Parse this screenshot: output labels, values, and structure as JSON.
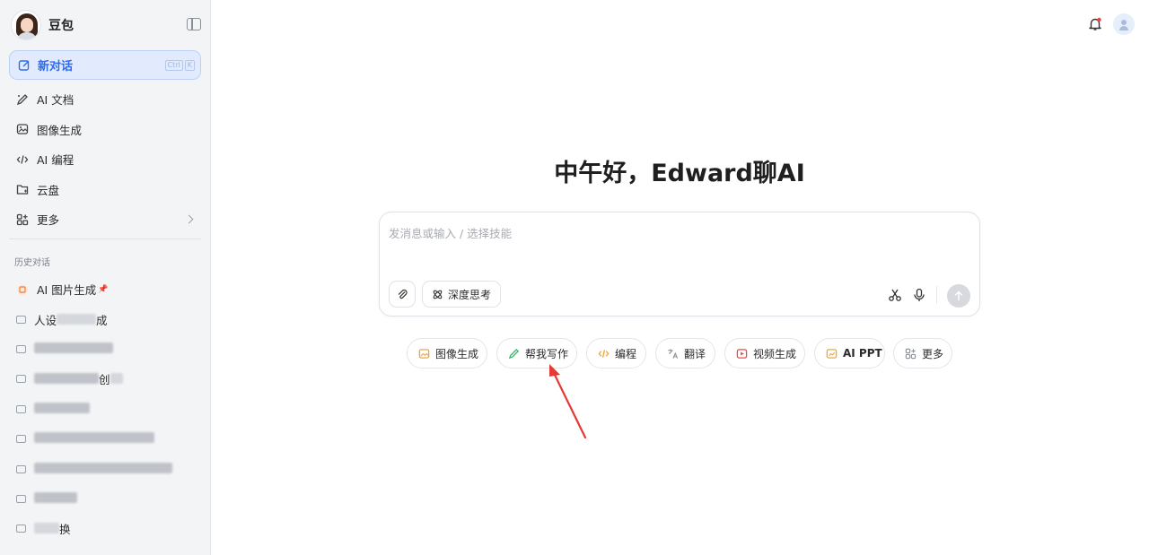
{
  "app": {
    "name": "豆包"
  },
  "sidebar": {
    "new_chat": {
      "label": "新对话",
      "shortcut": [
        "Ctrl",
        "K"
      ]
    },
    "nav": [
      {
        "label": "AI 文档",
        "icon": "pen-icon"
      },
      {
        "label": "图像生成",
        "icon": "image-icon"
      },
      {
        "label": "AI 编程",
        "icon": "code-icon"
      },
      {
        "label": "云盘",
        "icon": "cloud-drive-icon"
      },
      {
        "label": "更多",
        "icon": "grid-icon"
      }
    ],
    "history_title": "历史对话",
    "history": [
      {
        "label": "AI 图片生成",
        "pinned": true
      },
      {
        "label_prefix": "人设",
        "label_suffix": "成",
        "redacted": true
      },
      {
        "redacted": true
      },
      {
        "label_suffix": "创",
        "redacted": true
      },
      {
        "redacted": true
      },
      {
        "redacted": true
      },
      {
        "redacted": true
      },
      {
        "redacted": true
      },
      {
        "label_suffix": "换",
        "redacted": true
      }
    ]
  },
  "main": {
    "greeting": "中午好，Edward聊AI",
    "composer": {
      "placeholder": "发消息或输入 / 选择技能",
      "deep_think_label": "深度思考"
    },
    "skills": [
      {
        "label": "图像生成",
        "icon": "image-icon",
        "color": "#f0a53a"
      },
      {
        "label": "帮我写作",
        "icon": "pen-icon",
        "color": "#3db26b"
      },
      {
        "label": "编程",
        "icon": "code-icon",
        "color": "#f0a53a"
      },
      {
        "label": "翻译",
        "icon": "translate-icon",
        "color": "#8a8f99"
      },
      {
        "label": "视频生成",
        "icon": "video-icon",
        "color": "#f04848"
      },
      {
        "label": "AI PPT",
        "icon": "ppt-icon",
        "color": "#f0a53a"
      },
      {
        "label": "更多",
        "icon": "grid-icon",
        "color": "#8a94b8"
      }
    ]
  },
  "colors": {
    "accent": "#2f6bf0",
    "annotation_arrow": "#e53935"
  }
}
